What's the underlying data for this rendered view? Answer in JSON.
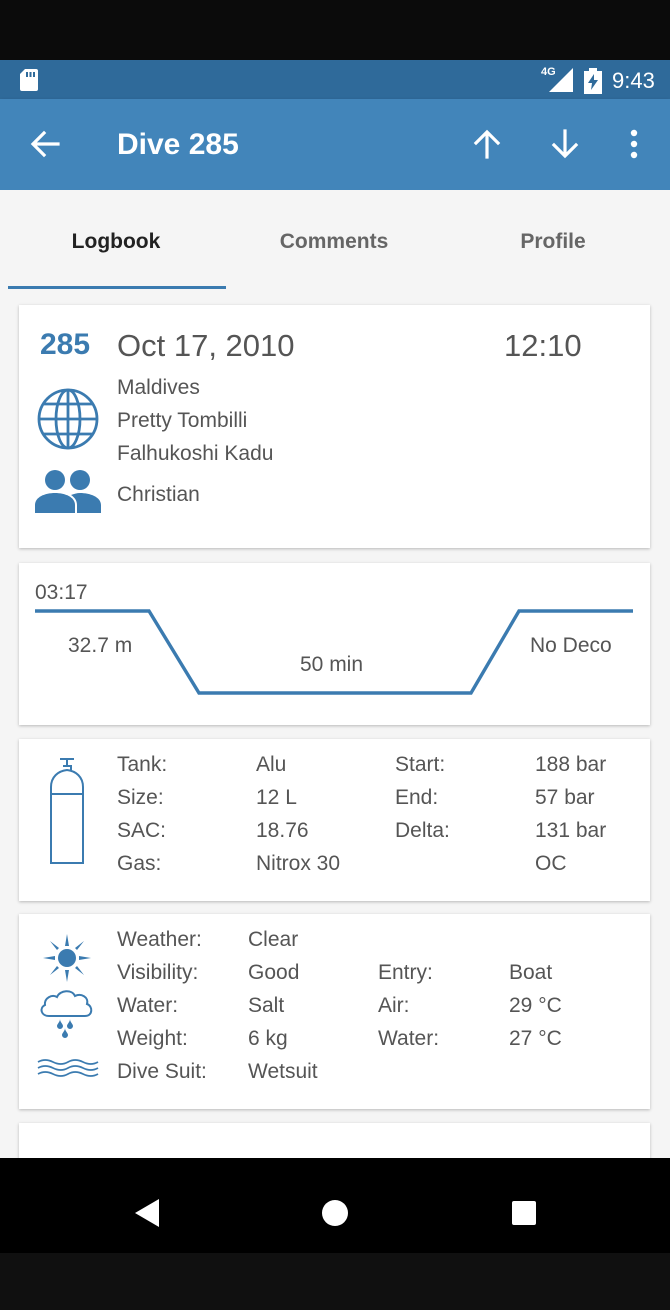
{
  "status_bar": {
    "network": "4G",
    "time": "9:43"
  },
  "app_bar": {
    "title": "Dive 285"
  },
  "tabs": [
    {
      "label": "Logbook"
    },
    {
      "label": "Comments"
    },
    {
      "label": "Profile"
    }
  ],
  "summary": {
    "number": "285",
    "date": "Oct 17, 2010",
    "time": "12:10",
    "location": [
      "Maldives",
      "Pretty Tombilli",
      "Falhukoshi Kadu"
    ],
    "buddy": "Christian"
  },
  "profile": {
    "time": "03:17",
    "depth": "32.7 m",
    "duration": "50 min",
    "deco": "No Deco"
  },
  "tank": {
    "rows": [
      [
        "Tank:",
        "Alu",
        "Start:",
        "188 bar"
      ],
      [
        "Size:",
        "12 L",
        "End:",
        "57 bar"
      ],
      [
        "SAC:",
        "18.76",
        "Delta:",
        "131 bar"
      ],
      [
        "Gas:",
        "Nitrox 30",
        "",
        "OC"
      ]
    ]
  },
  "conditions": {
    "rows": [
      [
        "Weather:",
        "Clear",
        "",
        ""
      ],
      [
        "Visibility:",
        "Good",
        "Entry:",
        "Boat"
      ],
      [
        "Water:",
        "Salt",
        "Air:",
        "29 °C"
      ],
      [
        "Weight:",
        "6 kg",
        "Water:",
        "27 °C"
      ],
      [
        "Dive Suit:",
        "Wetsuit",
        "",
        ""
      ]
    ]
  },
  "colors": {
    "accent": "#3b7bb0",
    "app_bar": "#4285ba",
    "status_bar": "#2f6a9a"
  }
}
